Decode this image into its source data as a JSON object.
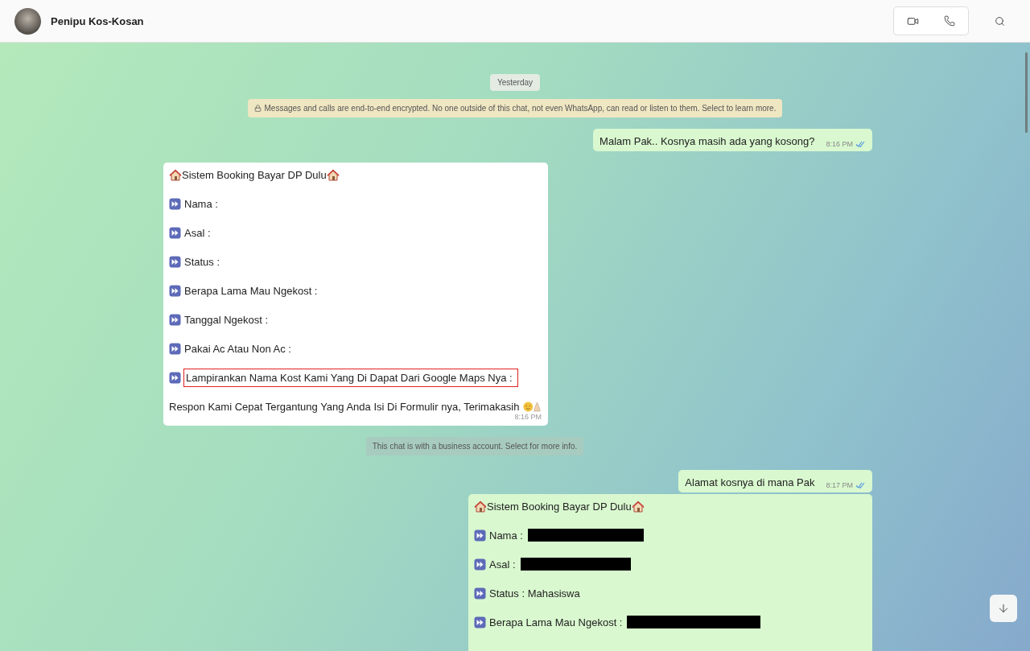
{
  "header": {
    "contact_name": "Penipu Kos-Kosan"
  },
  "messages": [
    {
      "kind": "date",
      "text": "Yesterday"
    },
    {
      "kind": "encryption",
      "text": "Messages and calls are end-to-end encrypted. No one outside of this chat, not even WhatsApp, can read or listen to them. Select to learn more."
    },
    {
      "kind": "outgoing",
      "text": "Malam Pak.. Kosnya masih ada yang kosong?",
      "time": "8:16 PM",
      "read": true
    },
    {
      "kind": "incoming_form",
      "time": "8:16 PM",
      "lines": [
        {
          "kind": "title",
          "text": "Sistem Booking Bayar DP Dulu"
        },
        {
          "kind": "bullet",
          "text": "Nama :",
          "redacted": false,
          "highlighted": false
        },
        {
          "kind": "bullet",
          "text": "Asal :",
          "redacted": false,
          "highlighted": false
        },
        {
          "kind": "bullet",
          "text": "Status :",
          "redacted": false,
          "highlighted": false
        },
        {
          "kind": "bullet",
          "text": "Berapa Lama Mau Ngekost :",
          "redacted": false,
          "highlighted": false
        },
        {
          "kind": "bullet",
          "text": "Tanggal Ngekost :",
          "redacted": false,
          "highlighted": false
        },
        {
          "kind": "bullet",
          "text": "Pakai Ac Atau Non Ac :",
          "redacted": false,
          "highlighted": false
        },
        {
          "kind": "bullet",
          "text": "Lampirankan Nama Kost Kami Yang Di Dapat Dari Google Maps Nya :",
          "redacted": false,
          "highlighted": true
        },
        {
          "kind": "closing",
          "text": "Respon Kami Cepat Tergantung Yang Anda Isi Di Formulir nya, Terimakasih"
        }
      ]
    },
    {
      "kind": "business",
      "text": "This chat is with a business account. Select for more info."
    },
    {
      "kind": "outgoing",
      "text": "Alamat kosnya di mana Pak",
      "time": "8:17 PM",
      "read": true
    },
    {
      "kind": "outgoing_form",
      "lines": [
        {
          "kind": "title",
          "text": "Sistem Booking Bayar DP Dulu"
        },
        {
          "kind": "bullet",
          "text": "Nama :",
          "redacted": true,
          "highlighted": false
        },
        {
          "kind": "bullet",
          "text": "Asal :",
          "redacted": true,
          "highlighted": false
        },
        {
          "kind": "bullet",
          "text": "Status : Mahasiswa",
          "redacted": false,
          "highlighted": false
        },
        {
          "kind": "bullet",
          "text": "Berapa Lama Mau Ngekost :",
          "redacted": true,
          "highlighted": false
        }
      ]
    }
  ]
}
